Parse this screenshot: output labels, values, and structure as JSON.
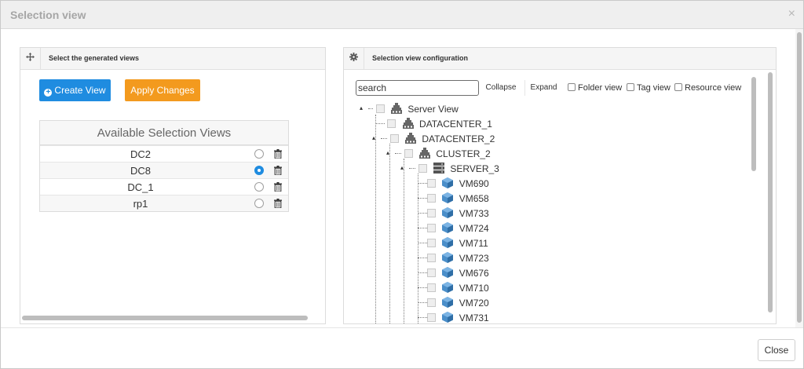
{
  "modal": {
    "title": "Selection view",
    "close_glyph": "×",
    "close_button": "Close"
  },
  "left_panel": {
    "title": "Select the generated views",
    "icon": "move-arrows-icon",
    "create_button": "Create View",
    "apply_button": "Apply Changes",
    "table_header": "Available Selection Views",
    "views": [
      {
        "name": "DC2",
        "selected": false
      },
      {
        "name": "DC8",
        "selected": true
      },
      {
        "name": "DC_1",
        "selected": false
      },
      {
        "name": "rp1",
        "selected": false
      }
    ]
  },
  "right_panel": {
    "title": "Selection view configuration",
    "icon": "gear-icon",
    "search": {
      "value": "",
      "placeholder": "search"
    },
    "collapse_button": "Collapse",
    "expand_button": "Expand",
    "filters": [
      {
        "label": "Folder view",
        "checked": false
      },
      {
        "label": "Tag view",
        "checked": false
      },
      {
        "label": "Resource view",
        "checked": false
      }
    ],
    "tree": {
      "root": {
        "label": "Server View",
        "icon": "datacenter-tree-icon"
      },
      "datacenters": [
        {
          "label": "DATACENTER_1",
          "icon": "datacenter-tree-icon"
        },
        {
          "label": "DATACENTER_2",
          "icon": "datacenter-tree-icon"
        }
      ],
      "cluster": {
        "label": "CLUSTER_2",
        "icon": "datacenter-tree-icon"
      },
      "server": {
        "label": "SERVER_3",
        "icon": "server-rack-icon"
      },
      "vms": [
        "VM690",
        "VM658",
        "VM733",
        "VM724",
        "VM711",
        "VM723",
        "VM676",
        "VM710",
        "VM720",
        "VM731"
      ]
    }
  },
  "colors": {
    "primary_button": "#1f8ce0",
    "warning_button": "#f39a1e",
    "vm_icon": "#4a8ec9"
  }
}
